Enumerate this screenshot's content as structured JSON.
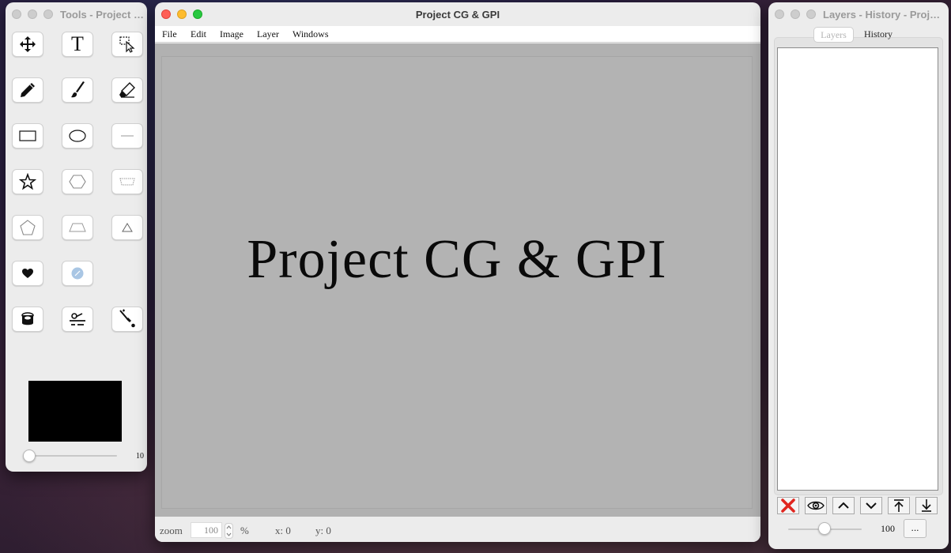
{
  "tools_window": {
    "title": "Tools - Project CG & GPI",
    "tools": [
      {
        "id": "move-tool",
        "icon": "move-arrows-icon"
      },
      {
        "id": "text-tool",
        "icon": "text-T-icon",
        "glyph": "T"
      },
      {
        "id": "select-tool",
        "icon": "selection-cursor-icon"
      },
      {
        "id": "pencil-tool",
        "icon": "pencil-icon"
      },
      {
        "id": "brush-tool",
        "icon": "brush-icon"
      },
      {
        "id": "eraser-tool",
        "icon": "eraser-icon"
      },
      {
        "id": "rectangle-tool",
        "icon": "rectangle-icon"
      },
      {
        "id": "ellipse-tool",
        "icon": "ellipse-icon"
      },
      {
        "id": "line-tool",
        "icon": "line-icon"
      },
      {
        "id": "star-tool",
        "icon": "star-icon"
      },
      {
        "id": "hexagon-tool",
        "icon": "hexagon-icon"
      },
      {
        "id": "parallelogram-tool",
        "icon": "parallelogram-icon"
      },
      {
        "id": "pentagon-tool",
        "icon": "pentagon-icon"
      },
      {
        "id": "trapezoid-tool",
        "icon": "trapezoid-icon"
      },
      {
        "id": "triangle-tool",
        "icon": "triangle-icon"
      },
      {
        "id": "heart-tool",
        "icon": "heart-icon"
      },
      {
        "id": "blur-tool",
        "icon": "blur-circle-icon"
      },
      {
        "id": "fill-tool",
        "icon": "paint-bucket-icon"
      },
      {
        "id": "filter-tool",
        "icon": "filter-icon"
      },
      {
        "id": "eyedropper-tool",
        "icon": "eyedropper-icon"
      }
    ],
    "color_swatch": "#000000",
    "brush_size_label": "10",
    "brush_size_value": 10
  },
  "main_window": {
    "title": "Project CG & GPI",
    "menu": [
      "File",
      "Edit",
      "Image",
      "Layer",
      "Windows"
    ],
    "canvas_text": "Project CG & GPI",
    "status": {
      "zoom_label": "zoom",
      "zoom_value": "100",
      "percent": "%",
      "x_label": "x: 0",
      "y_label": "y: 0"
    }
  },
  "layers_window": {
    "title": "Layers - History - Project CG & GPI",
    "tabs": [
      "Layers",
      "History"
    ],
    "active_tab": "Layers",
    "buttons": [
      {
        "id": "delete-layer",
        "icon": "red-x-icon"
      },
      {
        "id": "toggle-visibility",
        "icon": "eye-icon"
      },
      {
        "id": "move-up",
        "icon": "chevron-up-icon"
      },
      {
        "id": "move-down",
        "icon": "chevron-down-icon"
      },
      {
        "id": "move-top",
        "icon": "arrow-to-top-icon"
      },
      {
        "id": "move-bottom",
        "icon": "arrow-to-bottom-icon"
      }
    ],
    "opacity_label": "100",
    "opacity_value": 100,
    "more_label": "..."
  }
}
